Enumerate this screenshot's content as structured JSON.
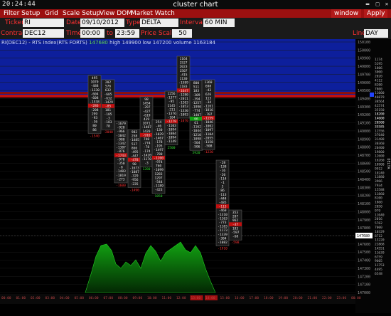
{
  "titlebar": {
    "clock": "20:24:44",
    "title": "cluster chart"
  },
  "menu": {
    "filter": "Filter Setup",
    "grid": "Grid",
    "scale": "Scale Setup",
    "dom": "View DOM",
    "watch": "Market Watch",
    "window": "window",
    "apply": "Apply"
  },
  "toolbar": {
    "ticker_label": "Ticker",
    "ticker": "RI",
    "date_label": "Date",
    "date": "09/10/2012",
    "type_label": "Type",
    "type": "DELTA",
    "interval_label": "Interval",
    "interval": "60 MIN",
    "contract_label": "Contract",
    "contract": "DEC12",
    "time_label": "Time",
    "time_from": "00:00",
    "to_label": "to",
    "time_to": "23:59",
    "price_scale_label": "Price Scale",
    "price_scale": "50",
    "line_label": "Line",
    "line": "DAY"
  },
  "info": {
    "symbol": "RI(DEC12) - RTS Index(RTS FORTS)",
    "last": "147680",
    "high": "high 149900",
    "low": "low 147200",
    "volume": "volume 1163184"
  },
  "colors": {
    "accent": "#9c1010",
    "positive": "#22dd22",
    "negative": "#ff3333",
    "profile": "#0d3cc0",
    "area": "#0a7a0a"
  },
  "price_axis": [
    "150100",
    "150000",
    "149900",
    "149800",
    "149700",
    "149600",
    "149500",
    "149400",
    "149300",
    "149200",
    "149100",
    "149000",
    "148900",
    "148800",
    "148700",
    "148600",
    "148500",
    "148400",
    "148300",
    "148200",
    "148100",
    "148000",
    "147900",
    "147800",
    "147700",
    "147600",
    "147500",
    "147400",
    "147300",
    "147200",
    "147100",
    "147000"
  ],
  "current_price": "147680",
  "side_label": "DELTA",
  "time_axis": [
    "00:00",
    "01:00",
    "02:00",
    "03:00",
    "04:00",
    "05:00",
    "06:00",
    "07:00",
    "08:00",
    "09:00",
    "10:00",
    "11:00",
    "12:00",
    "13:00",
    "14:00",
    "15:00",
    "16:00",
    "17:00",
    "18:00",
    "19:00",
    "20:00",
    "21:00",
    "22:00",
    "23:00",
    "00:00"
  ],
  "profile_values": [
    "1174",
    "5295",
    "1806",
    "3000",
    "2020",
    "4112",
    "8200",
    "7800",
    "11000",
    "46879",
    "38564",
    "42574",
    "35150",
    "18200",
    "14600",
    "20500",
    "35585",
    "12556",
    "37640",
    "31488",
    "30360",
    "20400",
    "19800",
    "12600",
    "16260",
    "18900",
    "9912",
    "10240",
    "11880",
    "3966",
    "7934",
    "15588",
    "11860",
    "8100",
    "1860",
    "2050",
    "979",
    "11040",
    "2016",
    "5762",
    "7000",
    "10329",
    "8712",
    "13220",
    "22868",
    "14551",
    "11639",
    "6759",
    "9605",
    "11753",
    "4495",
    "6548"
  ],
  "clusters": [
    {
      "time": "10:00",
      "total": "-1540",
      "values": [
        "495",
        "1070",
        "-488",
        "-1330",
        "-604",
        "-608",
        "-1538",
        "-286",
        "-208",
        "299",
        "-93",
        "-36",
        "80",
        "86"
      ]
    },
    {
      "time": "11:00",
      "total": "-2040",
      "values": [
        "202",
        "576",
        "632",
        "-685",
        "-632",
        "-1429",
        "-85",
        "181",
        "-185",
        "-3",
        "-183",
        "78"
      ]
    },
    {
      "time": "12:00",
      "total": "-1600",
      "values": [
        "-1679",
        "-928",
        "-966",
        "-1042",
        "-980",
        "-1342",
        "-1387",
        "-876",
        "-1743",
        "-978",
        "-350",
        "-8",
        "-1483",
        "-1819",
        "-273"
      ]
    },
    {
      "time": "13:00",
      "total": "-1490",
      "values": [
        "982",
        "258",
        "-1485",
        "517",
        "866",
        "-495",
        "-447",
        "-478",
        "90",
        "-1673",
        "-1087",
        "-329",
        "-956",
        "-235"
      ]
    },
    {
      "time": "14:00",
      "total": "1280",
      "values": [
        "98",
        "1454",
        "-297",
        "-427",
        "-619",
        "439",
        "1071",
        "-1487",
        "1420",
        "-916",
        "740",
        "-774",
        "-78",
        "-174",
        "-1420",
        "-1170",
        "-3"
      ]
    },
    {
      "time": "15:00",
      "total": "1850",
      "values": [
        "254",
        "-46",
        "-130",
        "-1029",
        "-1467",
        "-178",
        "-195",
        "-1497",
        "-780",
        "-1200",
        "-974",
        "760",
        "-1099",
        "1283",
        "1297",
        "-544",
        "-1189",
        "-423"
      ]
    },
    {
      "time": "16:00",
      "total": "2500",
      "values": [
        "1256",
        "-1377",
        "-95",
        "1145",
        "-211",
        "-1376",
        "-104",
        "-1279",
        "-1103",
        "-1094",
        "-1084",
        "-1094",
        "-1149"
      ]
    },
    {
      "time": "17:00",
      "total": "-1070",
      "values": [
        "1164",
        "1527",
        "2023",
        "1507",
        "-415",
        "1130",
        "-1589",
        "1183",
        "-1647",
        "-1280",
        "-2011",
        "-1203",
        "-1053",
        "-1330",
        "-1093"
      ]
    },
    {
      "time": "18:00",
      "total": "5920",
      "values": [
        "800",
        "511",
        "183",
        "-309",
        "-394",
        "-1257",
        "-1990",
        "-774",
        "-1407",
        "66",
        "61",
        "-1162",
        "-1044",
        "-1210",
        "-1098",
        "-504",
        "-506"
      ]
    },
    {
      "time": "19:00",
      "total": "-1220",
      "values": [
        "1360",
        "698",
        "-43",
        "626",
        "113",
        "-34",
        "-1161",
        "-1816",
        "-707",
        "-1159",
        "-1046",
        "-1002",
        "-1097",
        "-1104",
        "-2055",
        "-1158",
        "-508"
      ]
    },
    {
      "time": "20:00",
      "total": "-1910",
      "values": [
        "-28",
        "-138",
        "-16",
        "-20",
        "-114",
        "-1",
        "3",
        "86",
        "-113",
        "-444",
        "-485",
        "-113",
        "-460",
        "-1310",
        "-1163",
        "-773",
        "-1183",
        "-1173",
        "-1339",
        "-384",
        "-1082"
      ]
    },
    {
      "time": "21:00",
      "total": "-598",
      "values": [
        "353",
        "287",
        "962",
        "-47",
        "183",
        "-597",
        "-68"
      ]
    }
  ]
}
